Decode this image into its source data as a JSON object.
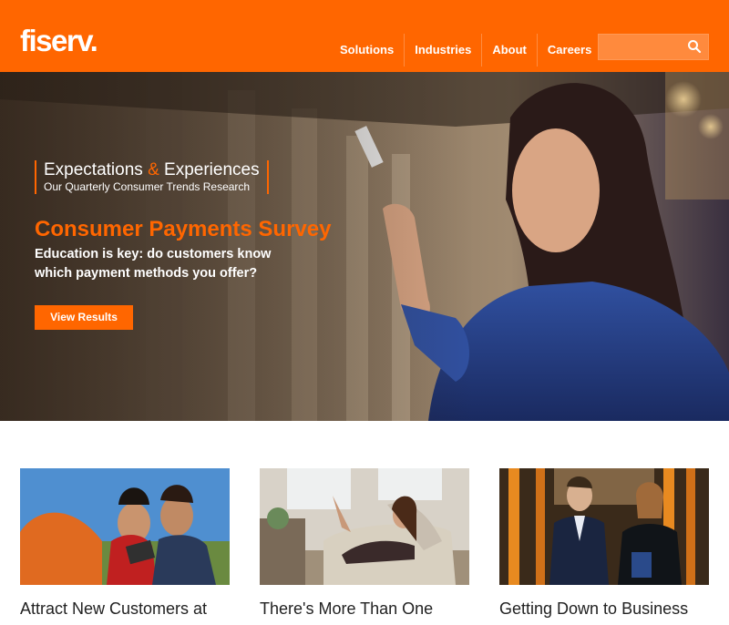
{
  "header": {
    "logo_text": "fiserv.",
    "nav": [
      "Solutions",
      "Industries",
      "About",
      "Careers"
    ],
    "search_placeholder": "",
    "brand_color": "#ff6600"
  },
  "hero": {
    "series_title_part1": "Expectations ",
    "series_title_amp": "&",
    "series_title_part2": " Experiences",
    "series_subtitle": "Our Quarterly Consumer Trends Research",
    "heading": "Consumer Payments Survey",
    "text": "Education is key: do customers know which payment methods you offer?",
    "button_label": "View Results"
  },
  "cards": [
    {
      "title": "Attract New Customers at"
    },
    {
      "title": "There's More Than One"
    },
    {
      "title": "Getting Down to Business"
    }
  ]
}
